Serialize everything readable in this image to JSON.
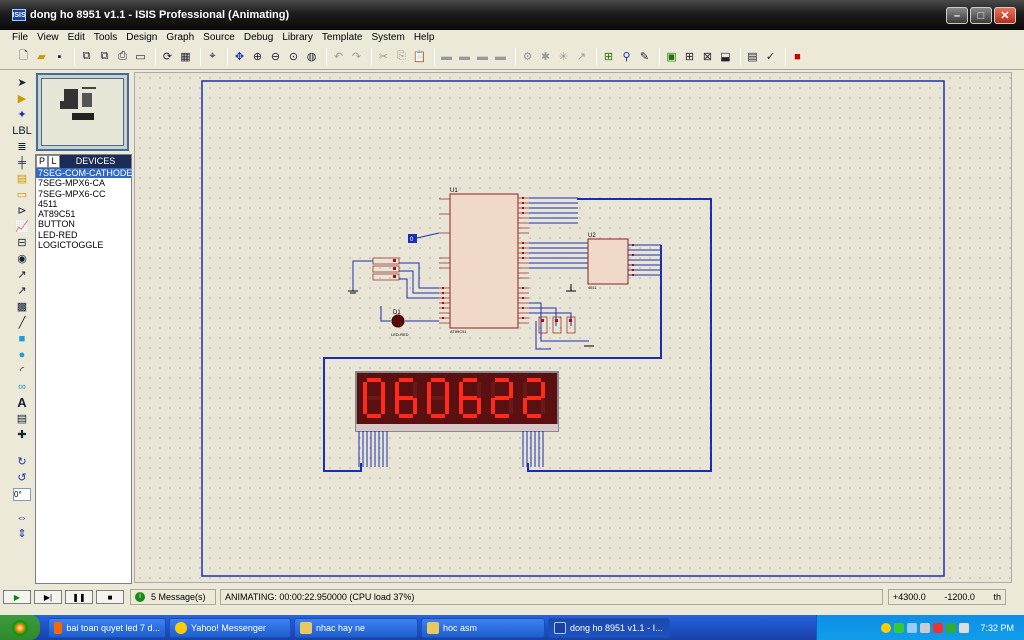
{
  "window": {
    "title": "dong ho 8951 v1.1 - ISIS Professional (Animating)",
    "app_icon": "ISIS"
  },
  "menu": [
    "File",
    "View",
    "Edit",
    "Tools",
    "Design",
    "Graph",
    "Source",
    "Debug",
    "Library",
    "Template",
    "System",
    "Help"
  ],
  "devices": {
    "header_p": "P",
    "header_l": "L",
    "title": "DEVICES",
    "items": [
      "7SEG-COM-CATHODE",
      "7SEG-MPX6-CA",
      "7SEG-MPX6-CC",
      "4511",
      "AT89C51",
      "BUTTON",
      "LED-RED",
      "LOGICTOGGLE"
    ],
    "selected_index": 0
  },
  "rotation_field": "0°",
  "schematic": {
    "display_digits": "060622",
    "u1_label": "U1",
    "u2_label": "U2",
    "d1_label": "D1",
    "logic_state": "0",
    "u1_part": "AT89C51",
    "u2_part": "4511",
    "d1_part": "LED-RED"
  },
  "status": {
    "messages": "5 Message(s)",
    "animating": "ANIMATING: 00:00:22.950000 (CPU load 37%)",
    "coord_x": "+4300.0",
    "coord_y": "-1200.0",
    "units": "th"
  },
  "taskbar": {
    "items": [
      "bai toan quyet led 7 d...",
      "Yahoo! Messenger",
      "nhac hay ne",
      "hoc asm",
      "dong ho 8951 v1.1 - I..."
    ],
    "clock": "7:32 PM"
  },
  "colors": {
    "wire_blue": "#1a2fb0",
    "segment_red": "#ff2a1a",
    "display_body": "#5a1010"
  }
}
